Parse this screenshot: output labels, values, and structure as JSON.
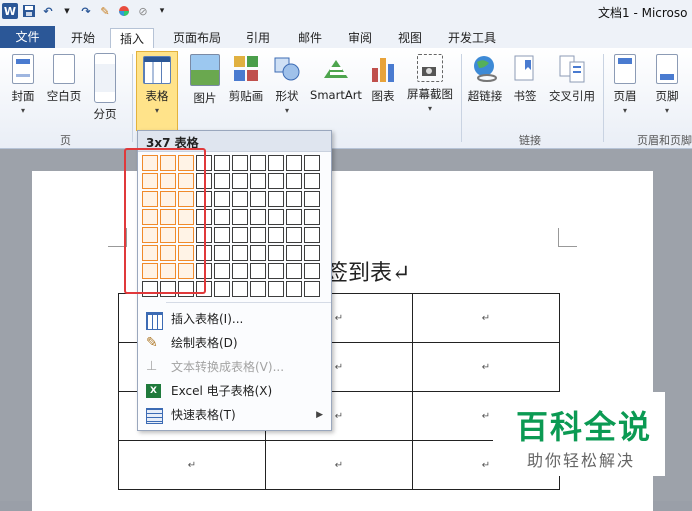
{
  "titlebar": {
    "doc_title": "文档1 - Microso"
  },
  "tabs": [
    {
      "label": "文件"
    },
    {
      "label": "开始"
    },
    {
      "label": "插入"
    },
    {
      "label": "页面布局"
    },
    {
      "label": "引用"
    },
    {
      "label": "邮件"
    },
    {
      "label": "审阅"
    },
    {
      "label": "视图"
    },
    {
      "label": "开发工具"
    }
  ],
  "ribbon": {
    "buttons": [
      {
        "label": "封面"
      },
      {
        "label": "空白页"
      },
      {
        "label": "分页"
      },
      {
        "label": "表格"
      },
      {
        "label": "图片"
      },
      {
        "label": "剪贴画"
      },
      {
        "label": "形状"
      },
      {
        "label": "SmartArt"
      },
      {
        "label": "图表"
      },
      {
        "label": "屏幕截图"
      },
      {
        "label": "超链接"
      },
      {
        "label": "书签"
      },
      {
        "label": "交叉引用"
      },
      {
        "label": "页眉"
      },
      {
        "label": "页脚"
      }
    ],
    "groups": [
      {
        "label": "页"
      },
      {
        "label": "链接"
      },
      {
        "label": "页眉和页脚"
      }
    ]
  },
  "table_dropdown": {
    "header": "3x7 表格",
    "grid_cols": 10,
    "grid_rows": 8,
    "selected_cols": 3,
    "selected_rows": 7,
    "items": [
      {
        "label": "插入表格(I)...",
        "disabled": false
      },
      {
        "label": "绘制表格(D)",
        "disabled": false
      },
      {
        "label": "文本转换成表格(V)...",
        "disabled": true
      },
      {
        "label": "Excel 电子表格(X)",
        "disabled": false
      },
      {
        "label": "快速表格(T)",
        "disabled": false,
        "submenu": true
      }
    ]
  },
  "document": {
    "heading": "签到表↵",
    "cell_mark": "↵"
  },
  "watermark": {
    "title": "百科全说",
    "subtitle": "助你轻松解决"
  },
  "colors": {
    "accent": "#2b5797",
    "selection": "#f08a2a",
    "highlight_box": "#e0393b",
    "watermark": "#0b9a53"
  }
}
